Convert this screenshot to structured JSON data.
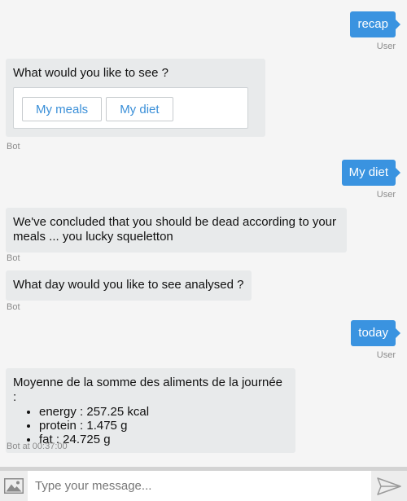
{
  "conversation": {
    "user_msg_1": "recap",
    "user_label_1": "User",
    "bot_msg_1": "What would you like to see ?",
    "quick_replies": [
      "My meals",
      "My diet"
    ],
    "bot_label_1": "Bot",
    "user_msg_2": "My diet",
    "user_label_2": "User",
    "bot_msg_2": "We've concluded that you should be dead according to your meals ... you lucky squeletton",
    "bot_label_2": "Bot",
    "bot_msg_3": "What day would you like to see analysed ?",
    "bot_label_3": "Bot",
    "user_msg_3": "today",
    "user_label_3": "User",
    "bot_msg_4_title": "Moyenne de la somme des aliments de la journée :",
    "bot_msg_4_items": [
      "energy : 257.25 kcal",
      "protein : 1.475 g",
      "fat : 24.725 g"
    ],
    "bot_label_4": "Bot at 00:37:00"
  },
  "composer": {
    "placeholder": "Type your message...",
    "image_icon": "image-icon",
    "send_icon": "send-icon"
  },
  "colors": {
    "user_bubble": "#3a93e0",
    "bot_bubble": "#e8eaeb",
    "background": "#f5f5f5",
    "quick_reply_text": "#3a8fd8"
  }
}
